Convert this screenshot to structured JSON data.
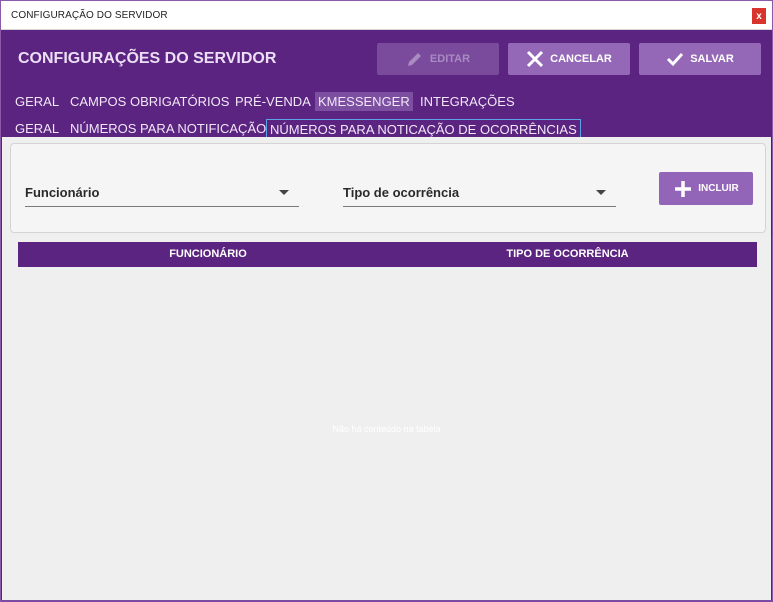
{
  "window": {
    "title": "CONFIGURAÇÃO DO SERVIDOR",
    "close_label": "x"
  },
  "header": {
    "title": "CONFIGURAÇÕES DO SERVIDOR",
    "edit_label": "EDITAR",
    "cancel_label": "CANCELAR",
    "save_label": "SALVAR"
  },
  "tabs_main": [
    {
      "label": "GERAL"
    },
    {
      "label": "CAMPOS OBRIGATÓRIOS"
    },
    {
      "label": "PRÉ-VENDA"
    },
    {
      "label": "KMESSENGER"
    },
    {
      "label": "INTEGRAÇÕES"
    }
  ],
  "tabs_sub": [
    {
      "label": "GERAL"
    },
    {
      "label": "NÚMEROS PARA NOTIFICAÇÃO"
    },
    {
      "label": "NÚMEROS PARA NOTICAÇÃO DE OCORRÊNCIAS"
    }
  ],
  "filters": {
    "employee_label": "Funcionário",
    "occurrence_label": "Tipo de ocorrência",
    "add_label": "INCLUIR"
  },
  "table": {
    "columns": [
      "FUNCIONÁRIO",
      "TIPO DE OCORRÊNCIA"
    ],
    "empty_message": "Não há conteúdo na tabela"
  },
  "colors": {
    "brand": "#5b2480",
    "button": "#9468b6",
    "close": "#d9342b"
  }
}
